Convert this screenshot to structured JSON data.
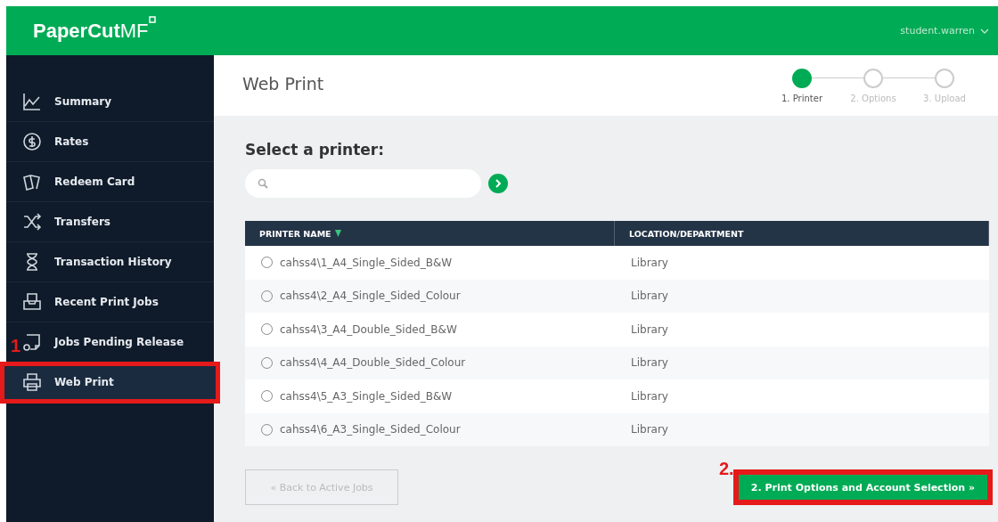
{
  "header": {
    "logo": "PaperCut",
    "logo_suffix": "MF",
    "user": "student.warren"
  },
  "sidebar": {
    "items": [
      {
        "label": "Summary",
        "selected": false,
        "highlighted": false
      },
      {
        "label": "Rates",
        "selected": false,
        "highlighted": false
      },
      {
        "label": "Redeem Card",
        "selected": false,
        "highlighted": false
      },
      {
        "label": "Transfers",
        "selected": false,
        "highlighted": false
      },
      {
        "label": "Transaction History",
        "selected": false,
        "highlighted": false
      },
      {
        "label": "Recent Print Jobs",
        "selected": false,
        "highlighted": false
      },
      {
        "label": "Jobs Pending Release",
        "selected": false,
        "highlighted": false
      },
      {
        "label": "Web Print",
        "selected": true,
        "highlighted": true
      }
    ]
  },
  "page_title": "Web Print",
  "steps": [
    {
      "label": "1. Printer",
      "selected": true
    },
    {
      "label": "2. Options",
      "selected": false
    },
    {
      "label": "3. Upload",
      "selected": false
    }
  ],
  "heading": "Select a printer:",
  "table": {
    "columns": [
      "PRINTER NAME",
      "LOCATION/DEPARTMENT"
    ],
    "rows": [
      {
        "name": "cahss4\\1_A4_Single_Sided_B&W",
        "location": "Library",
        "selected": false
      },
      {
        "name": "cahss4\\2_A4_Single_Sided_Colour",
        "location": "Library",
        "selected": false
      },
      {
        "name": "cahss4\\3_A4_Double_Sided_B&W",
        "location": "Library",
        "selected": false
      },
      {
        "name": "cahss4\\4_A4_Double_Sided_Colour",
        "location": "Library",
        "selected": false
      },
      {
        "name": "cahss4\\5_A3_Single_Sided_B&W",
        "location": "Library",
        "selected": false
      },
      {
        "name": "cahss4\\6_A3_Single_Sided_Colour",
        "location": "Library",
        "selected": false
      }
    ]
  },
  "back_button": "« Back to Active Jobs",
  "next_button": {
    "label": "2. Print Options and Account Selection »",
    "highlighted": true
  },
  "annotations": [
    {
      "label": "1"
    },
    {
      "label": "2."
    }
  ]
}
